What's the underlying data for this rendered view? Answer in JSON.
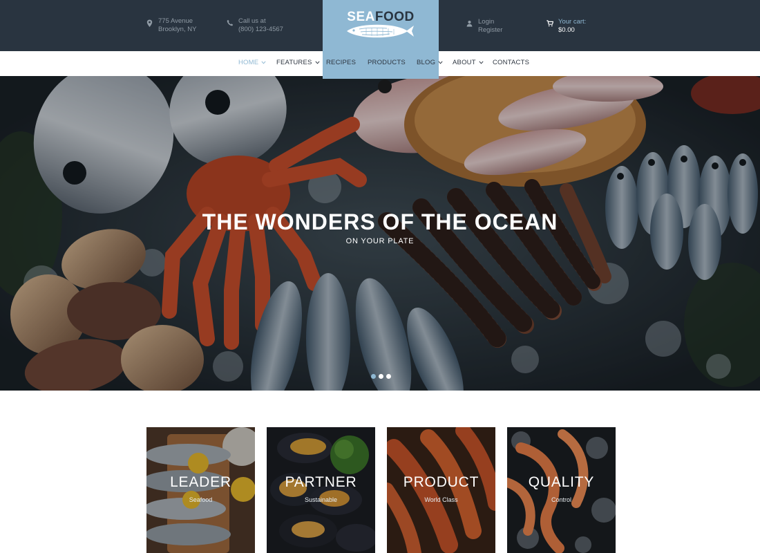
{
  "topbar": {
    "address": {
      "line1": "775 Avenue",
      "line2": "Brooklyn, NY"
    },
    "call": {
      "line1": "Call us at",
      "line2": "(800) 123-4567"
    },
    "account": {
      "login": "Login",
      "register": "Register"
    },
    "cart": {
      "label": "Your cart:",
      "total": "$0.00"
    }
  },
  "logo": {
    "part1": "SEA",
    "part2": "FOOD"
  },
  "nav": [
    {
      "label": "HOME",
      "active": true,
      "dropdown": true
    },
    {
      "label": "FEATURES",
      "dropdown": true
    },
    {
      "label": "RECIPES"
    },
    {
      "label": "PRODUCTS"
    },
    {
      "label": "BLOG",
      "dropdown": true
    },
    {
      "label": "ABOUT",
      "dropdown": true
    },
    {
      "label": "CONTACTS"
    }
  ],
  "hero": {
    "title": "THE WONDERS OF THE OCEAN",
    "subtitle": "ON YOUR PLATE",
    "slides": 3,
    "active_slide": 1
  },
  "features": [
    {
      "title": "LEADER",
      "subtitle": "Seafood"
    },
    {
      "title": "PARTNER",
      "subtitle": "Sustainable"
    },
    {
      "title": "PRODUCT",
      "subtitle": "World Class"
    },
    {
      "title": "QUALITY",
      "subtitle": "Control"
    }
  ],
  "colors": {
    "topbar_bg": "#293440",
    "accent": "#8fb8d3",
    "nav_text": "#2d3540",
    "page_bg": "#ffffff"
  },
  "icons": {
    "address": "map-pin-icon",
    "call": "phone-icon",
    "account": "user-icon",
    "cart": "cart-icon",
    "nav_dropdown": "chevron-down-icon"
  }
}
